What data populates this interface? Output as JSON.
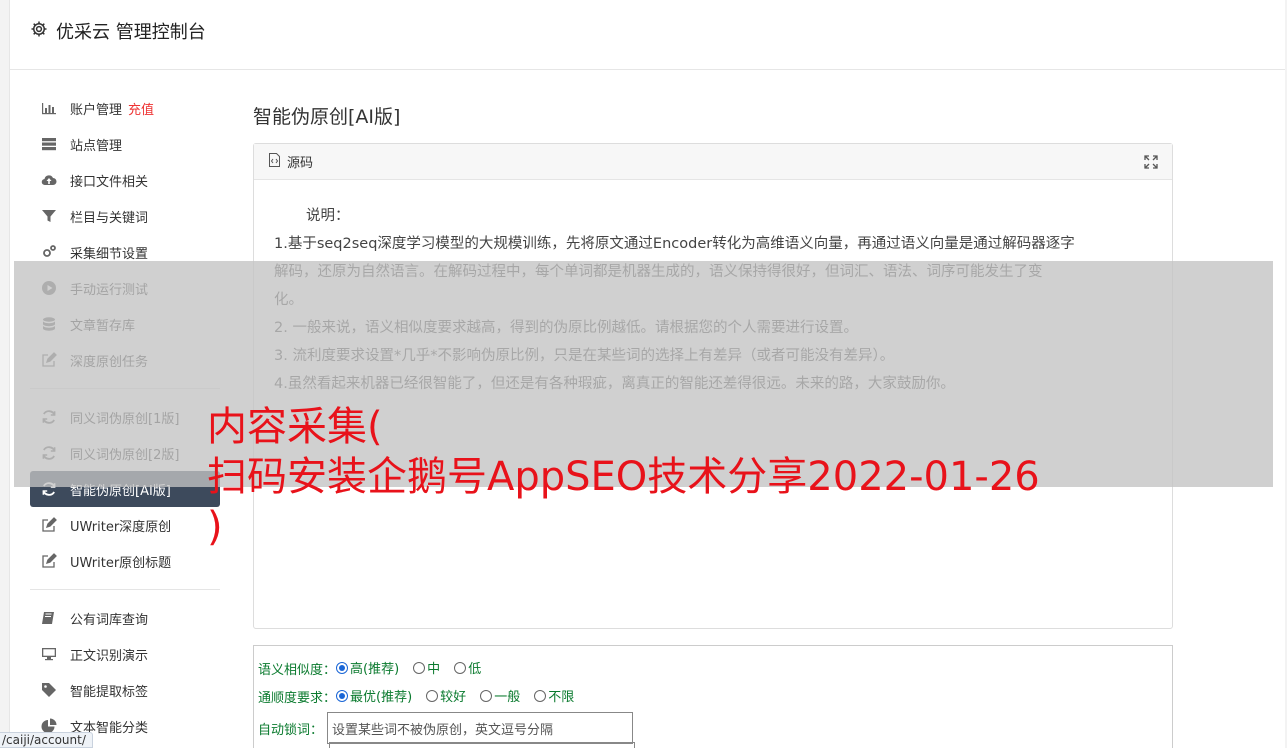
{
  "header": {
    "title": "优采云 管理控制台"
  },
  "sidebar": {
    "recharge_label": "充值",
    "group1": [
      {
        "label": "账户管理",
        "icon": "bar-chart-icon"
      },
      {
        "label": "站点管理",
        "icon": "server-icon"
      },
      {
        "label": "接口文件相关",
        "icon": "cloud-upload-icon"
      },
      {
        "label": "栏目与关键词",
        "icon": "filter-icon"
      },
      {
        "label": "采集细节设置",
        "icon": "gears-icon"
      },
      {
        "label": "手动运行测试",
        "icon": "play-circle-icon"
      },
      {
        "label": "文章暂存库",
        "icon": "database-icon"
      },
      {
        "label": "深度原创任务",
        "icon": "edit-icon"
      }
    ],
    "group2": [
      {
        "label": "同义词伪原创[1版]",
        "icon": "refresh-icon"
      },
      {
        "label": "同义词伪原创[2版]",
        "icon": "refresh-icon"
      },
      {
        "label": "智能伪原创[AI版]",
        "icon": "refresh-icon",
        "active": true
      },
      {
        "label": "UWriter深度原创",
        "icon": "edit-icon"
      },
      {
        "label": "UWriter原创标题",
        "icon": "edit-icon"
      }
    ],
    "group3": [
      {
        "label": "公有词库查询",
        "icon": "book-icon"
      },
      {
        "label": "正文识别演示",
        "icon": "monitor-icon"
      },
      {
        "label": "智能提取标签",
        "icon": "tag-icon"
      },
      {
        "label": "文本智能分类",
        "icon": "pie-chart-icon"
      }
    ]
  },
  "main": {
    "title": "智能伪原创[AI版]",
    "panel": {
      "tab_label": "源码",
      "intro": "说明：",
      "lines": [
        "1.基于seq2seq深度学习模型的大规模训练，先将原文通过Encoder转化为高维语义向量，再通过语义向量是通过解码器逐字",
        "解码，还原为自然语言。在解码过程中，每个单词都是机器生成的，语义保持得很好，但词汇、语法、词序可能发生了变",
        "化。",
        "2. 一般来说，语义相似度要求越高，得到的伪原比例越低。请根据您的个人需要进行设置。",
        "3. 流利度要求设置*几乎*不影响伪原比例，只是在某些词的选择上有差异（或者可能没有差异）。",
        "4.虽然看起来机器已经很智能了，但还是有各种瑕疵，离真正的智能还差得很远。未来的路，大家鼓励你。"
      ]
    },
    "form": {
      "similarity": {
        "label": "语义相似度：",
        "options": [
          "高(推荐)",
          "中",
          "低"
        ],
        "selected": 0
      },
      "fluency": {
        "label": "通顺度要求：",
        "options": [
          "最优(推荐)",
          "较好",
          "一般",
          "不限"
        ],
        "selected": 0
      },
      "lock": {
        "label": "自动锁词：",
        "placeholder": "设置某些词不被伪原创，英文逗号分隔"
      }
    }
  },
  "overlay": {
    "line1": "内容采集(",
    "line2": "扫码安装企鹅号AppSEO技术分享2022-01-26",
    "line3": ")"
  },
  "statusbar": {
    "url": "/caiji/account/"
  }
}
